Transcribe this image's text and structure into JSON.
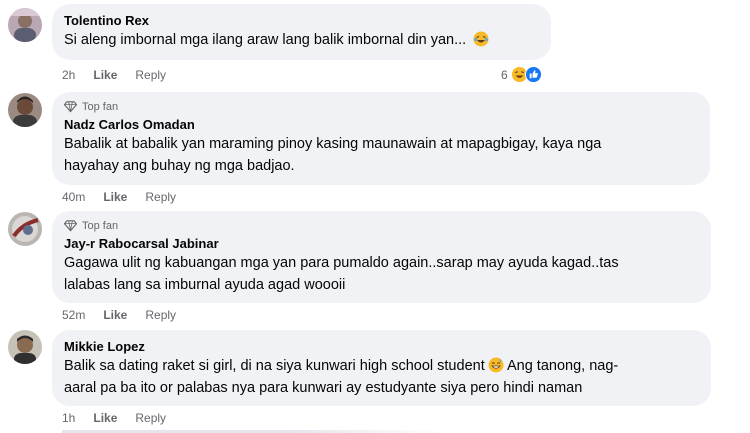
{
  "comments": [
    {
      "top_fan": false,
      "author": "Tolentino Rex",
      "text_lines": [
        "Si aleng imbornal mga ilang araw lang balik imbornal din yan..."
      ],
      "trailing_emoji": "laughing-tears-emoji",
      "time": "2h",
      "like_label": "Like",
      "reply_label": "Reply",
      "reaction_count": "6",
      "reaction_icons": [
        "haha-icon",
        "like-icon"
      ]
    },
    {
      "top_fan": true,
      "top_fan_label": "Top fan",
      "author": "Nadz Carlos Omadan",
      "text_lines": [
        "Babalik at babalik yan maraming pinoy kasing maunawain at mapagbigay, kaya nga",
        "hayahay ang buhay ng mga badjao."
      ],
      "time": "40m",
      "like_label": "Like",
      "reply_label": "Reply"
    },
    {
      "top_fan": true,
      "top_fan_label": "Top fan",
      "author": "Jay-r Rabocarsal Jabinar",
      "text_lines": [
        "Gagawa ulit ng kabuangan mga yan para pumaldo again..sarap may ayuda kagad..tas",
        "lalabas lang sa imburnal ayuda agad woooii"
      ],
      "time": "52m",
      "like_label": "Like",
      "reply_label": "Reply"
    },
    {
      "top_fan": false,
      "author": "Mikkie Lopez",
      "text_lines": [
        "Balik sa dating raket si girl, di na siya kunwari high school student",
        "Ang tanong, nag-",
        "aaral pa ba ito or palabas nya para kunwari ay estudyante siya pero hindi naman"
      ],
      "inline_emoji": "grinning-sweat-emoji",
      "time": "1h",
      "like_label": "Like",
      "reply_label": "Reply"
    }
  ],
  "colors": {
    "bubble": "#f0f2f5",
    "meta_text": "#65676b",
    "like_blue": "#1877f2",
    "haha_yellow": "#f7b928"
  }
}
